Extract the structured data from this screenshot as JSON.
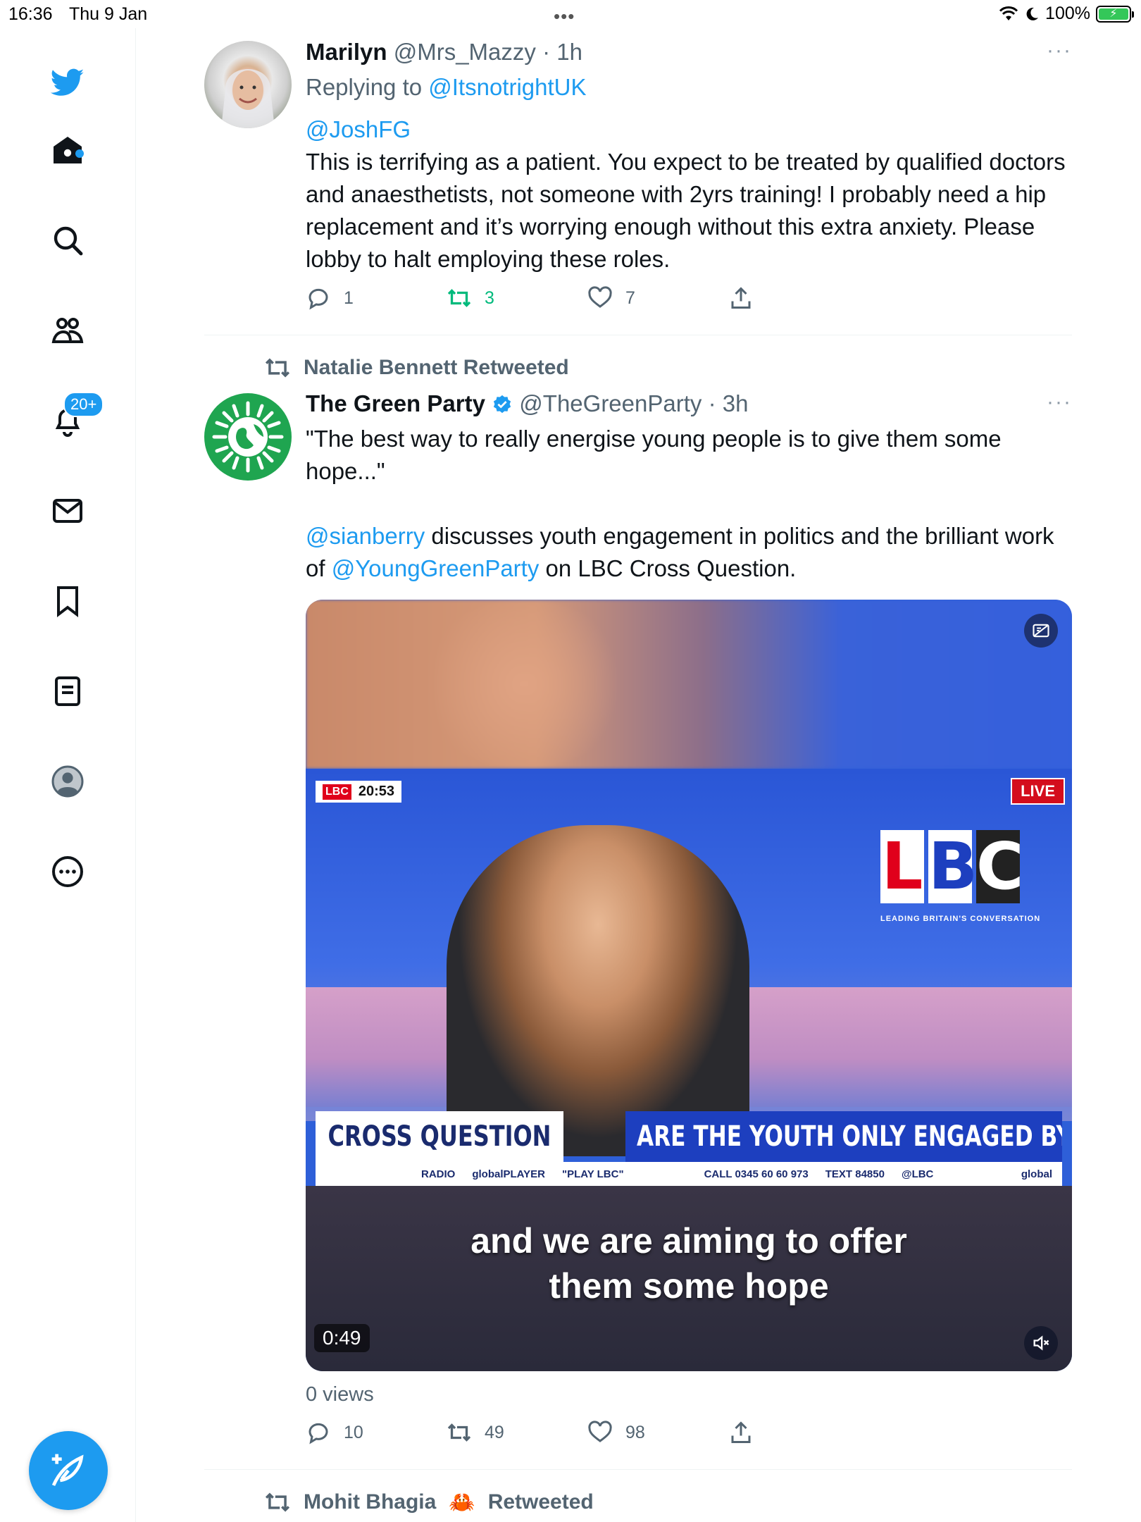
{
  "status_bar": {
    "time": "16:36",
    "date": "Thu 9 Jan",
    "battery": "100%",
    "grabber": "•••"
  },
  "sidebar": {
    "notifications_badge": "20+",
    "items": [
      "twitter-logo",
      "home-icon",
      "search-icon",
      "communities-icon",
      "notifications-icon",
      "messages-icon",
      "bookmarks-icon",
      "lists-icon",
      "profile-icon",
      "more-icon"
    ]
  },
  "tweet1": {
    "name": "Marilyn",
    "handle": "@Mrs_Mazzy",
    "time": "· 1h",
    "replying_prefix": "Replying to ",
    "replying_to": "@ItsnotrightUK",
    "mention": "@JoshFG",
    "text": "This is terrifying as a patient. You expect to be treated by qualified doctors and anaesthetists, not someone with 2yrs training! I probably need a hip replacement and it’s worrying enough without this extra anxiety. Please lobby to halt employing these roles.",
    "replies": "1",
    "retweets": "3",
    "likes": "7",
    "more": "···"
  },
  "tweet2": {
    "retweeted_by": "Natalie Bennett Retweeted",
    "name": "The Green Party",
    "handle": "@TheGreenParty",
    "time": "· 3h",
    "quote": "\"The best way to really energise young people is to give them some hope...\"",
    "mention1": "@sianberry",
    "text1": " discusses youth engagement in politics and the brilliant work of ",
    "mention2": "@YoungGreenParty",
    "text2": " on LBC Cross Question.",
    "more": "···",
    "video": {
      "lbc_small_logo": "LBC",
      "clock": "20:53",
      "live": "LIVE",
      "logo_l": "L",
      "logo_b": "B",
      "logo_c": "C",
      "tagline": "LEADING BRITAIN'S CONVERSATION",
      "show_name": "CROSS QUESTION",
      "headline": "ARE THE YOUTH ONLY ENGAGED BY REFORM?",
      "ticker_radio": "RADIO",
      "ticker_global": "globalPLAYER",
      "ticker_play": "\"PLAY LBC\"",
      "ticker_call": "CALL 0345 60 60 973",
      "ticker_text": "TEXT 84850",
      "ticker_handle": "@LBC",
      "ticker_brand": "global",
      "caption_line1": "and we are aiming to offer",
      "caption_line2": "them some hope",
      "duration": "0:49"
    },
    "views": "0 views",
    "replies": "10",
    "retweets": "49",
    "likes": "98"
  },
  "tweet3": {
    "retweeted_by_name": "Mohit Bhagia",
    "retweeted_by_emoji": "🦀",
    "retweeted_suffix": "Retweeted"
  },
  "colors": {
    "accent": "#1d9bf0",
    "retweet_active": "#00ba7c",
    "muted": "#536471",
    "green_party": "#1fa550"
  }
}
